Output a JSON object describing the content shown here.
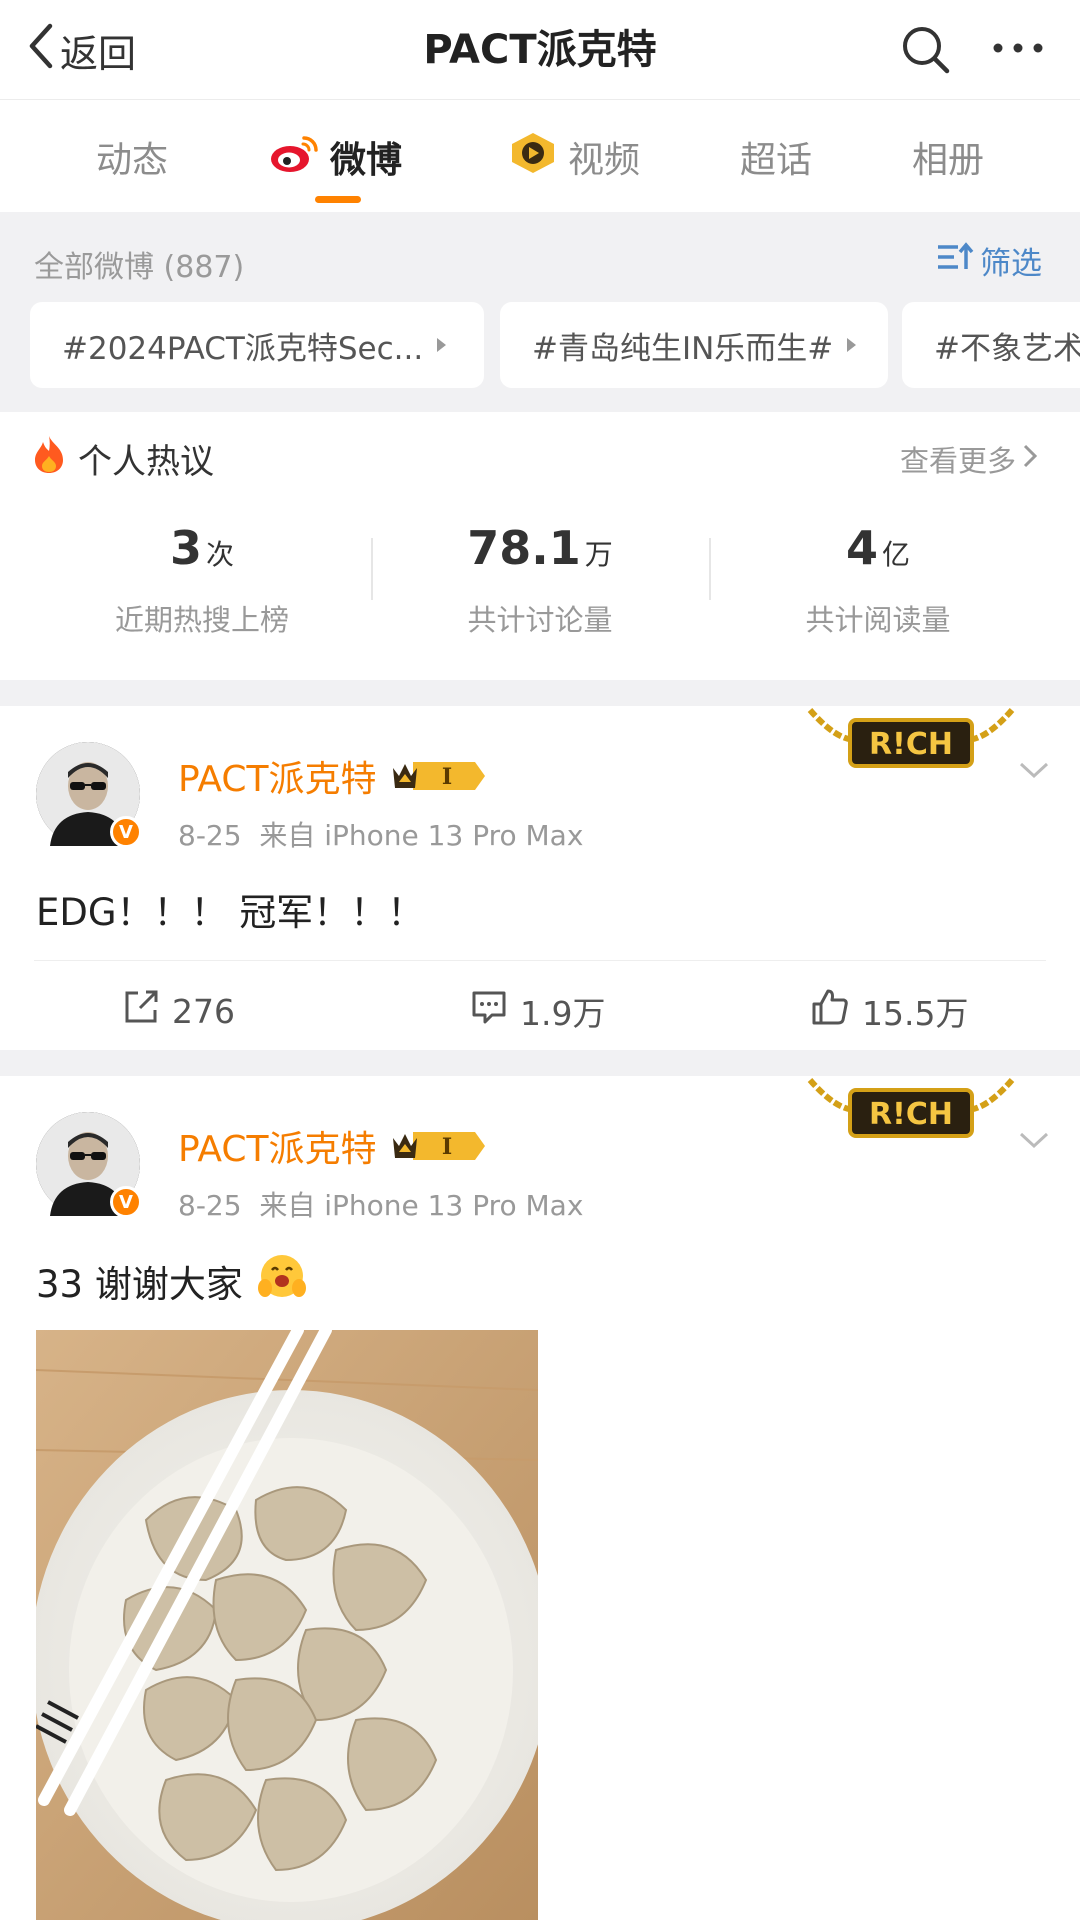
{
  "header": {
    "back_label": "返回",
    "title": "PACT派克特",
    "icons": [
      "chevron-left-icon",
      "search-icon",
      "more-icon"
    ]
  },
  "tabs": [
    {
      "label": "动态",
      "active": false
    },
    {
      "label": "微博",
      "active": true,
      "icon": "weibo-icon"
    },
    {
      "label": "视频",
      "active": false,
      "icon": "video-icon"
    },
    {
      "label": "超话",
      "active": false
    },
    {
      "label": "相册",
      "active": false
    }
  ],
  "filter": {
    "all_label": "全部微博 (887)",
    "filter_button": "筛选",
    "topics": [
      "#2024PACT派克特Sec...",
      "#青岛纯生IN乐而生#",
      "#不象艺术"
    ]
  },
  "hot_topics": {
    "title": "个人热议",
    "see_more": "查看更多",
    "stats": [
      {
        "value": "3",
        "unit": "次",
        "label": "近期热搜上榜"
      },
      {
        "value": "78.1",
        "unit": "万",
        "label": "共计讨论量"
      },
      {
        "value": "4",
        "unit": "亿",
        "label": "共计阅读量"
      }
    ]
  },
  "posts": [
    {
      "author": "PACT派克特",
      "verified_badge": "V",
      "vip_level": "I",
      "decoration": "R!CH",
      "date": "8-25",
      "source": "来自 iPhone 13 Pro Max",
      "text": "EDG！！！ 冠军！！！",
      "reposts": "276",
      "comments": "1.9万",
      "likes": "15.5万"
    },
    {
      "author": "PACT派克特",
      "verified_badge": "V",
      "vip_level": "I",
      "decoration": "R!CH",
      "date": "8-25",
      "source": "来自 iPhone 13 Pro Max",
      "text": "33 谢谢大家",
      "emoji": "hug-emoji-icon",
      "image": "dumplings-photo"
    }
  ],
  "colors": {
    "accent": "#ff8200",
    "author": "#f57d00",
    "link": "#4d88c8",
    "background_gray": "#f1f1f3"
  }
}
